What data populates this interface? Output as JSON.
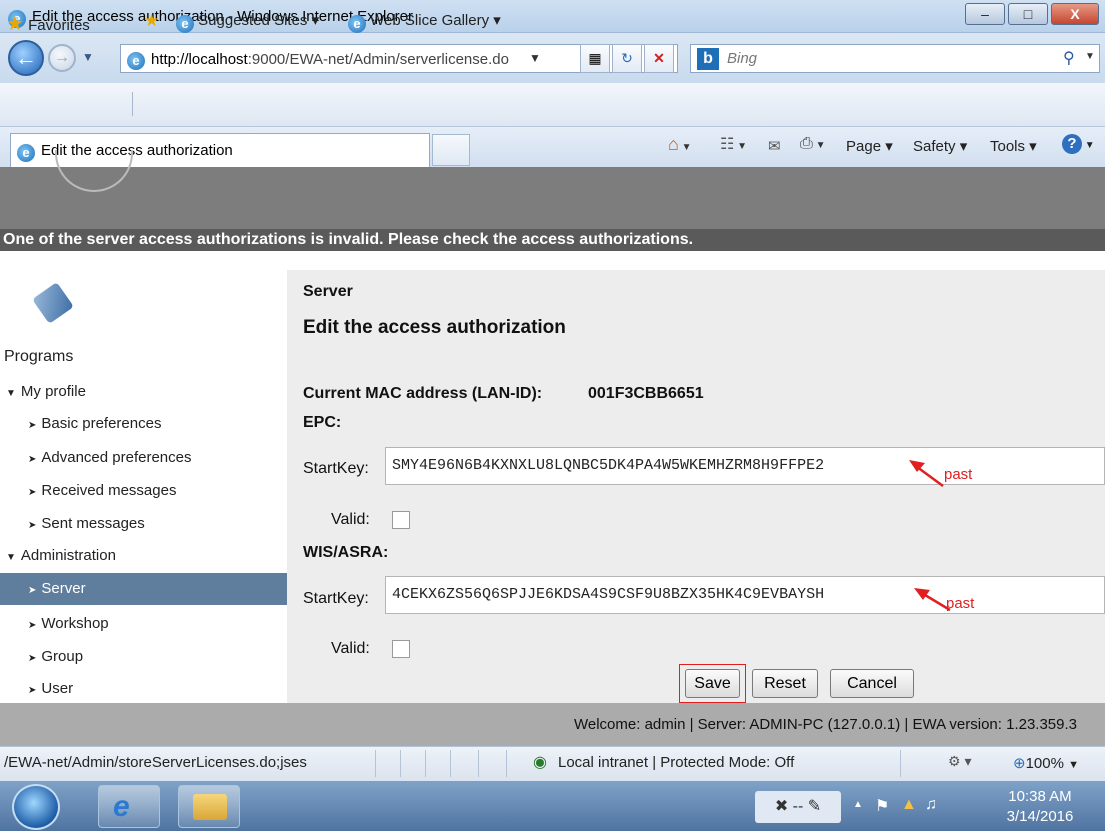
{
  "browser": {
    "window_title": "Edit the access authorization - Windows Internet Explorer",
    "minimize": "–",
    "maximize": "□",
    "close": "X",
    "url_host": "http://localhost",
    "url_rest": ":9000/EWA-net/Admin/serverlicense.do",
    "search_placeholder": "Bing",
    "favorites_label": "Favorites",
    "favorites_links": [
      "Suggested Sites ▾",
      "Web Slice Gallery ▾"
    ],
    "tab_title": "Edit the access authorization",
    "commands": [
      "Page ▾",
      "Safety ▾",
      "Tools ▾"
    ],
    "status_url": "/EWA-net/Admin/storeServerLicenses.do;jses",
    "status_zone": "Local intranet | Protected Mode: Off",
    "zoom": "100%"
  },
  "page": {
    "alert": "One of the server access authorizations is invalid. Please check the access authorizations.",
    "sidebar": {
      "programs": "Programs",
      "my_profile": "My profile",
      "profile_items": [
        "Basic preferences",
        "Advanced preferences",
        "Received messages",
        "Sent messages"
      ],
      "administration": "Administration",
      "admin_items": [
        "Server",
        "Workshop",
        "Group",
        "User"
      ],
      "active_item": "Server"
    },
    "breadcrumb": "Server",
    "title": "Edit the access authorization",
    "mac_label": "Current MAC address (LAN-ID):",
    "mac_value": "001F3CBB6651",
    "epc": {
      "heading": "EPC:",
      "startkey_label": "StartKey:",
      "startkey_value": "SMY4E96N6B4KXNXLU8LQNBC5DK4PA4W5WKEMHZRM8H9FFPE2",
      "valid_label": "Valid:",
      "valid_checked": false,
      "annotation": "past"
    },
    "wis": {
      "heading": "WIS/ASRA:",
      "startkey_label": "StartKey:",
      "startkey_value": "4CEKX6ZS56Q6SPJJE6KDSA4S9CSF9U8BZX35HK4C9EVBAYSH",
      "valid_label": "Valid:",
      "valid_checked": false,
      "annotation": "past"
    },
    "buttons": {
      "save": "Save",
      "reset": "Reset",
      "cancel": "Cancel"
    },
    "footer": "Welcome: admin | Server: ADMIN-PC (127.0.0.1) | EWA version: 1.23.359.3"
  },
  "taskbar": {
    "time": "10:38 AM",
    "date": "3/14/2016"
  },
  "colors": {
    "sidebar_active": "#5f7d9c",
    "alert_bar": "#5a5a5a",
    "annotation": "#e02020"
  }
}
